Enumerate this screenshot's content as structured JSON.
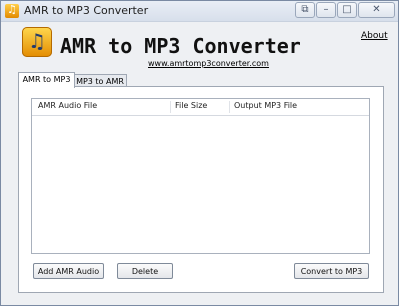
{
  "window": {
    "title": "AMR to MP3 Converter"
  },
  "header": {
    "app_title": "AMR to MP3 Converter",
    "website": "www.amrtomp3converter.com",
    "about_label": "About"
  },
  "tabs": [
    {
      "label": "AMR to MP3",
      "selected": true
    },
    {
      "label": "MP3 to AMR",
      "selected": false
    }
  ],
  "file_list": {
    "columns": [
      "AMR Audio File",
      "File Size",
      "Output MP3 File"
    ],
    "rows": []
  },
  "buttons": {
    "add": "Add AMR Audio",
    "delete": "Delete",
    "convert": "Convert to MP3"
  },
  "icons": {
    "app": "music-note-icon",
    "logo": "music-note-icon",
    "pin": "pin-icon",
    "minimize": "minimize-icon",
    "maximize": "maximize-icon",
    "close": "close-icon"
  },
  "colors": {
    "logo_orange": "#f2a000",
    "window_border": "#7a8aa3"
  }
}
